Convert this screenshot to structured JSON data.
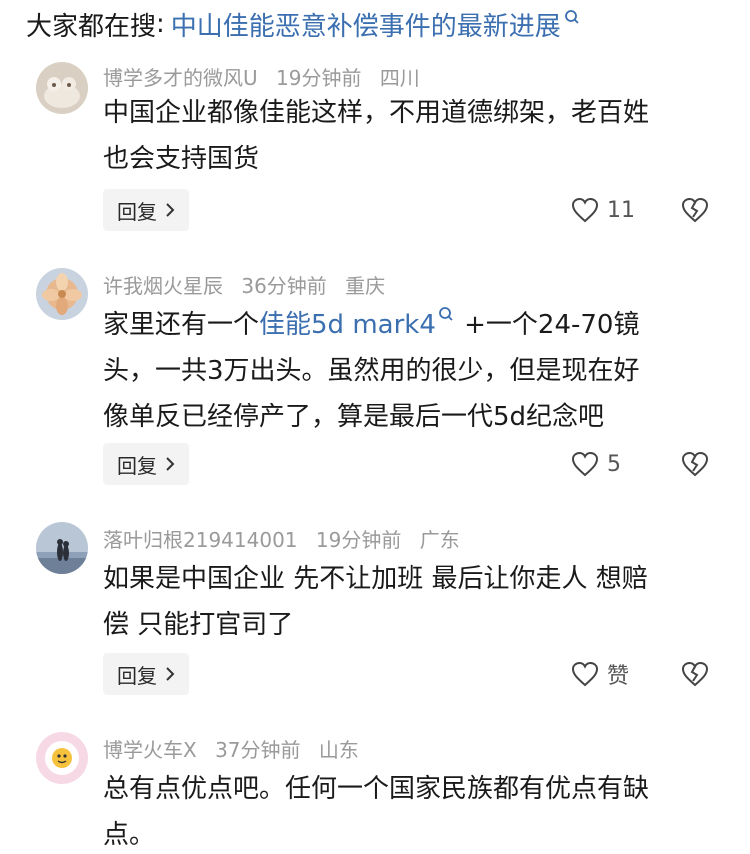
{
  "header": {
    "prefix": "大家都在搜",
    "colon": ":",
    "topic": "中山佳能恶意补偿事件的最新进展"
  },
  "comments": [
    {
      "user": "博学多才的微风U",
      "time": "19分钟前",
      "location": "四川",
      "lines": [
        "中国企业都像佳能这样，不用道德绑架，老百姓",
        "也会支持国货"
      ],
      "reply_label": "回复",
      "like_count": "11"
    },
    {
      "user": "许我烟火星辰",
      "time": "36分钟前",
      "location": "重庆",
      "line1_prefix": "家里还有一个",
      "line1_link": "佳能5d mark4",
      "line1_suffix": " +一个24-70镜",
      "lines": [
        "头，一共3万出头。虽然用的很少，但是现在好",
        "像单反已经停产了，算是最后一代5d纪念吧"
      ],
      "reply_label": "回复",
      "like_count": "5"
    },
    {
      "user": "落叶归根219414001",
      "time": "19分钟前",
      "location": "广东",
      "lines": [
        "如果是中国企业 先不让加班 最后让你走人 想赔",
        "偿 只能打官司了"
      ],
      "reply_label": "回复",
      "like_count": "赞"
    },
    {
      "user": "博学火车X",
      "time": "37分钟前",
      "location": "山东",
      "lines": [
        "总有点优点吧。任何一个国家民族都有优点有缺",
        "点。"
      ]
    }
  ],
  "icons": {
    "search": "search-icon",
    "heart": "heart-icon",
    "broken_heart": "broken-heart-icon",
    "chevron": "chevron-right-icon"
  },
  "colors": {
    "link": "#3b6fb0",
    "meta": "#9a9a9a",
    "reply_bg": "#f3f3f3"
  }
}
